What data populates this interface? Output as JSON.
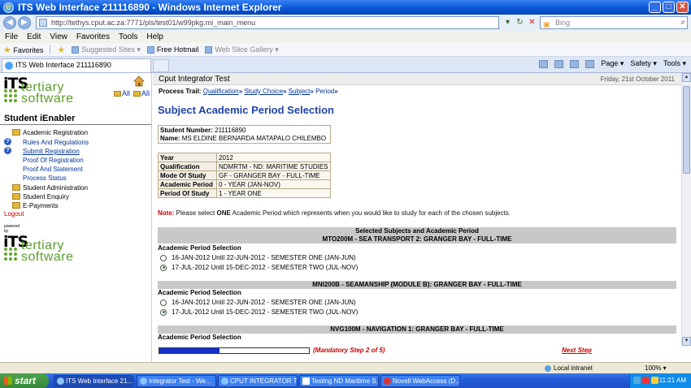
{
  "window": {
    "title": "ITS Web Interface 211116890 - Windows Internet Explorer",
    "controls": [
      "_",
      "□",
      "✕"
    ]
  },
  "browser": {
    "address": "http://tethys.cput.ac.za:7771/pls/test01/w99pkg.mi_main_menu",
    "search_placeholder": "Bing",
    "menu": [
      "File",
      "Edit",
      "View",
      "Favorites",
      "Tools",
      "Help"
    ],
    "favorites_label": "Favorites",
    "favorites_items": [
      "Suggested Sites ▾",
      "Free Hotmail",
      "Web Slice Gallery ▾"
    ],
    "tab_label": "ITS Web Interface 211116890",
    "commands": [
      "Page ▾",
      "Safety ▾",
      "Tools ▾"
    ]
  },
  "sidebar": {
    "logo_its": "iTS",
    "logo_word1": "tertiary",
    "logo_word2": "software",
    "all_links": [
      "All",
      "All"
    ],
    "title": "Student iEnabler",
    "items": [
      {
        "label": "Academic Registration"
      },
      {
        "label": "Rules And Regulations"
      },
      {
        "label": "Submit Registration"
      },
      {
        "label": "Proof Of Registration"
      },
      {
        "label": "Proof And Statement"
      },
      {
        "label": "Process Status"
      },
      {
        "label": "Student Administration"
      },
      {
        "label": "Student Enquiry"
      },
      {
        "label": "E-Payments"
      }
    ],
    "logout": "Logout",
    "powered_by_1": "powered",
    "powered_by_2": "by"
  },
  "main": {
    "system_name": "Cput Integrator Test",
    "date": "Friday, 21st October 2011",
    "trail_label": "Process Trail:",
    "trail": [
      "Qualification",
      "Study Choice",
      "Subject",
      "Period"
    ],
    "page_title": "Subject Academic Period Selection",
    "student_number_label": "Student Number:",
    "student_number": "211116890",
    "name_label": "Name:",
    "name": "MS ELDINE BERNARDA MATAPALO CHILEMBO",
    "details": [
      {
        "label": "Year",
        "value": "2012"
      },
      {
        "label": "Qualification",
        "value": "NDMRTM - ND: MARITIME STUDIES"
      },
      {
        "label": "Mode Of Study",
        "value": "GF - GRANGER BAY - FULL-TIME"
      },
      {
        "label": "Academic Period",
        "value": "0 - YEAR (JAN-NOV)"
      },
      {
        "label": "Period Of Study",
        "value": "1 - YEAR ONE"
      }
    ],
    "note_label": "Note:",
    "note_pre": " Please select ",
    "note_one": "ONE",
    "note_post": " Academic Period which represents when you would like to study for each of the chosen subjects.",
    "section_title": "Selected Subjects and Academic Period",
    "subjects": [
      {
        "header": "MTO200M - SEA TRANSPORT 2: GRANGER BAY - FULL-TIME",
        "selection_label": "Academic Period Selection",
        "options": [
          {
            "label": "16-JAN-2012 Until 22-JUN-2012 - SEMESTER ONE (JAN-JUN)",
            "checked": false
          },
          {
            "label": "17-JUL-2012 Until 15-DEC-2012 - SEMESTER TWO (JUL-NOV)",
            "checked": true
          }
        ]
      },
      {
        "header": "MNI200B - SEAMANSHIP (MODULE B): GRANGER BAY - FULL-TIME",
        "selection_label": "Academic Period Selection",
        "options": [
          {
            "label": "16-JAN-2012 Until 22-JUN-2012 - SEMESTER ONE (JAN-JUN)",
            "checked": false
          },
          {
            "label": "17-JUL-2012 Until 15-DEC-2012 - SEMESTER TWO (JUL-NOV)",
            "checked": true
          }
        ]
      },
      {
        "header": "NVG100M - NAVIGATION 1: GRANGER BAY - FULL-TIME",
        "selection_label": "Academic Period Selection",
        "options": []
      }
    ],
    "progress_fraction": 0.4,
    "mandatory_text": "(Mandatory Step 2 of 5)",
    "next_step": "Next Step"
  },
  "statusbar": {
    "zone": "Local intranet",
    "zoom": "100% ▾"
  },
  "taskbar": {
    "start": "start",
    "tasks": [
      "ITS Web Interface 21...",
      "Integrator Test - We...",
      "CPUT INTEGRATOR T...",
      "Testing ND Maritime S...",
      "Novell WebAccess (D..."
    ],
    "clock": "11:21 AM"
  }
}
